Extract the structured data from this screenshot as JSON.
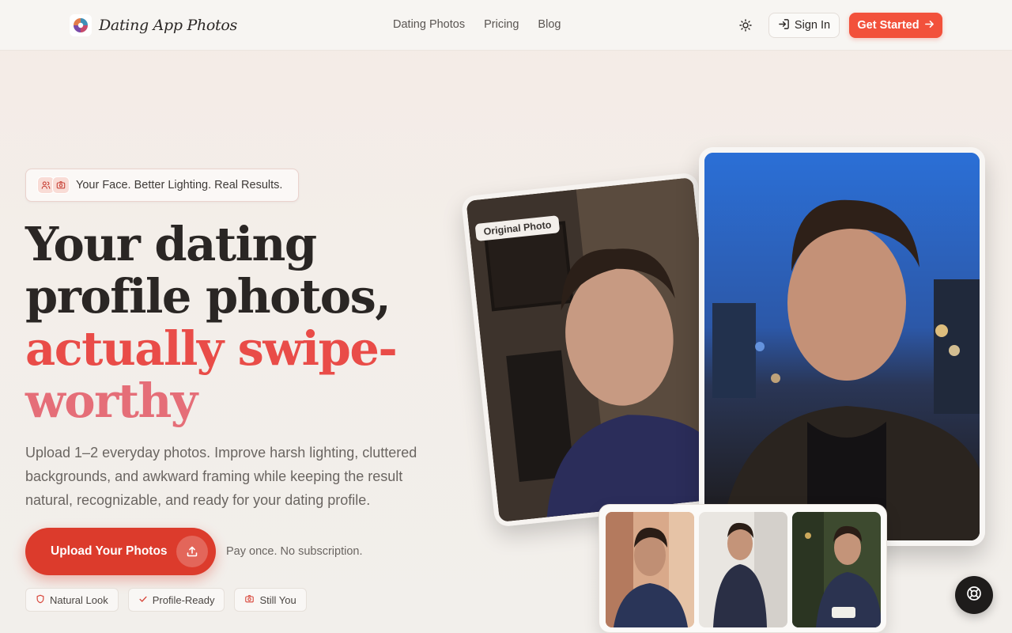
{
  "header": {
    "brand": "Dating App Photos",
    "nav": [
      "Dating Photos",
      "Pricing",
      "Blog"
    ],
    "theme_icon": "sun-icon",
    "signin_label": "Sign In",
    "get_started_label": "Get Started"
  },
  "hero": {
    "tagline": "Your Face. Better Lighting. Real Results.",
    "headline_lines": [
      "Your dating",
      "profile photos,",
      "actually swipe-",
      "worthy"
    ],
    "subtext": "Upload 1–2 everyday photos. Improve harsh lighting, cluttered backgrounds, and awkward framing while keeping the result natural, recognizable, and ready for your dating profile.",
    "upload_label": "Upload Your Photos",
    "pay_note": "Pay once. No subscription.",
    "chips": [
      "Natural Look",
      "Profile-Ready",
      "Still You"
    ]
  },
  "gallery": {
    "original_label": "Original Photo"
  },
  "colors": {
    "accent": "#f2513b",
    "upload": "#dc3b2c",
    "headline_accent_1": "#e94c48",
    "headline_accent_2": "#e56e78"
  }
}
